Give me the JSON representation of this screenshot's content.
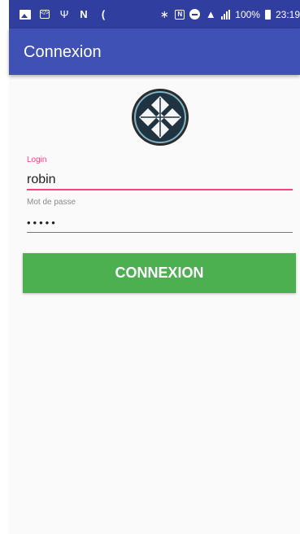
{
  "status_bar": {
    "battery": "100%",
    "time": "23:19",
    "icons": [
      "image-icon",
      "code-icon",
      "usb-icon",
      "n-icon",
      "moon-icon",
      "bluetooth-icon",
      "nfc-icon",
      "do-not-disturb-icon",
      "wifi-icon",
      "signal-icon",
      "battery-icon"
    ]
  },
  "app_bar": {
    "title": "Connexion",
    "color": "#3f51b5"
  },
  "form": {
    "login_label": "Login",
    "login_value": "robin",
    "password_label": "Mot de passe",
    "password_value": "robin",
    "submit_label": "CONNEXION"
  },
  "colors": {
    "accent": "#ff4081",
    "button": "#4caf50",
    "status_bar": "#303f9f"
  }
}
